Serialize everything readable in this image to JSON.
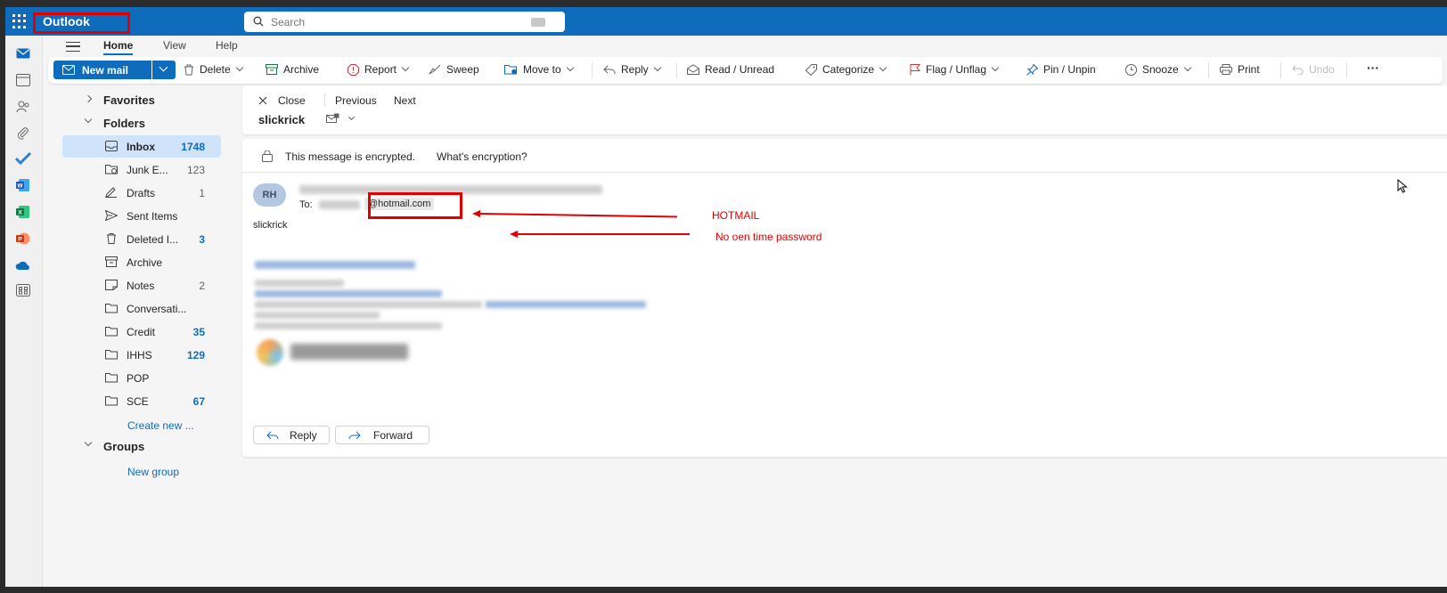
{
  "app": {
    "name": "Outlook"
  },
  "search": {
    "placeholder": "Search"
  },
  "tabs": [
    "Home",
    "View",
    "Help"
  ],
  "ribbon": {
    "new_mail": "New mail",
    "delete": "Delete",
    "archive": "Archive",
    "report": "Report",
    "sweep": "Sweep",
    "move_to": "Move to",
    "reply": "Reply",
    "read_unread": "Read / Unread",
    "categorize": "Categorize",
    "flag_unflag": "Flag / Unflag",
    "pin_unpin": "Pin / Unpin",
    "snooze": "Snooze",
    "print": "Print",
    "undo": "Undo",
    "more": "···"
  },
  "folders": {
    "favorites": "Favorites",
    "folders": "Folders",
    "items": [
      {
        "label": "Inbox",
        "count": "1748"
      },
      {
        "label": "Junk E...",
        "count": "123"
      },
      {
        "label": "Drafts",
        "count": "1"
      },
      {
        "label": "Sent Items",
        "count": ""
      },
      {
        "label": "Deleted I...",
        "count": "3"
      },
      {
        "label": "Archive",
        "count": ""
      },
      {
        "label": "Notes",
        "count": "2"
      },
      {
        "label": "Conversati...",
        "count": ""
      },
      {
        "label": "Credit",
        "count": "35"
      },
      {
        "label": "IHHS",
        "count": "129"
      },
      {
        "label": "POP",
        "count": ""
      },
      {
        "label": "SCE",
        "count": "67"
      }
    ],
    "create_new": "Create new ...",
    "groups": "Groups",
    "new_group": "New group"
  },
  "reading": {
    "close": "Close",
    "previous": "Previous",
    "next": "Next",
    "subject": "slickrick",
    "encrypted_note": "This message is encrypted.",
    "whats_encryption": "What's encryption?",
    "avatar_initials": "RH",
    "to_label": "To:",
    "to_address": "@hotmail.com",
    "body": "slickrick",
    "reply": "Reply",
    "forward": "Forward"
  },
  "annotations": {
    "hotmail": "HOTMAIL",
    "no_otp": "No oen time password"
  },
  "colors": {
    "brand": "#0f6cbd",
    "annotation": "#e00000",
    "selected": "#cfe4fa"
  }
}
